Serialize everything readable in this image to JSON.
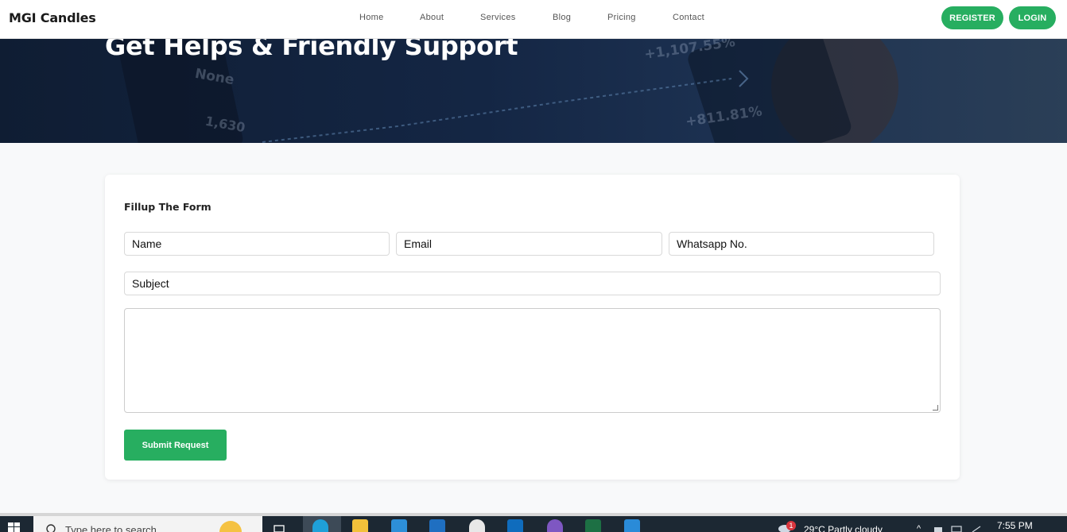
{
  "brand": "MGI Candles",
  "nav": {
    "links": [
      "Home",
      "About",
      "Services",
      "Blog",
      "Pricing",
      "Contact"
    ],
    "register": "REGISTER",
    "login": "LOGIN"
  },
  "hero": {
    "title": "Get Helps & Friendly Support",
    "background_text": [
      "+1,107.55%",
      "None",
      "1,630",
      "+811.81%"
    ]
  },
  "form": {
    "title": "Fillup The Form",
    "name_placeholder": "Name",
    "email_placeholder": "Email",
    "whatsapp_placeholder": "Whatsapp No.",
    "subject_placeholder": "Subject",
    "message_placeholder": "",
    "submit": "Submit Request"
  },
  "taskbar": {
    "search_placeholder": "Type here to search",
    "weather": "29°C  Partly cloudy",
    "time": "7:55 PM",
    "notification_count": "1"
  },
  "colors": {
    "accent": "#27ae60",
    "hero_bg": "#142644",
    "taskbar_bg": "#1c2833"
  },
  "icons": [
    "windows-start-icon",
    "search-icon",
    "sun-icon",
    "task-view-icon",
    "edge-icon",
    "file-explorer-icon",
    "store-icon",
    "mail-icon",
    "photos-icon",
    "outlook-icon",
    "tor-icon",
    "excel-icon",
    "vscode-icon",
    "weather-icon",
    "tray-chevron-icon",
    "network-icon"
  ]
}
